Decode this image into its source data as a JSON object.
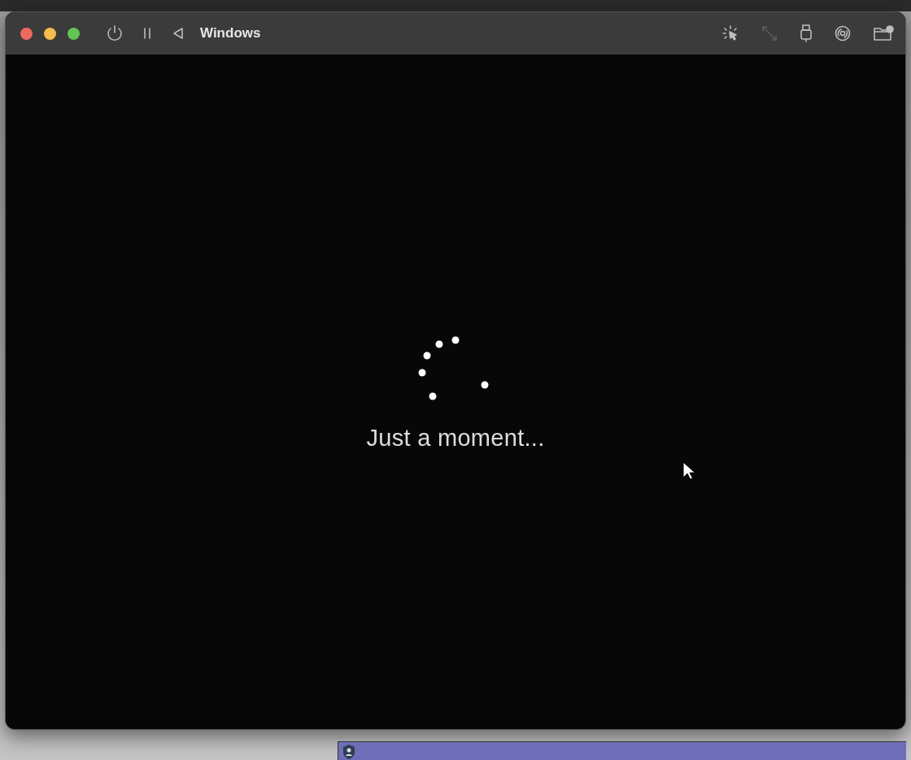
{
  "window": {
    "title": "Windows"
  },
  "toolbar_left": [
    {
      "kind": "power",
      "disabled": false
    },
    {
      "kind": "pause",
      "disabled": false
    },
    {
      "kind": "back",
      "disabled": false
    }
  ],
  "toolbar_right": [
    {
      "kind": "capture-cursor",
      "disabled": false
    },
    {
      "kind": "resize",
      "disabled": true
    },
    {
      "kind": "usb",
      "disabled": false
    },
    {
      "kind": "disc",
      "disabled": false
    },
    {
      "kind": "shared-folder",
      "disabled": false
    }
  ],
  "screen": {
    "message": "Just a moment..."
  }
}
